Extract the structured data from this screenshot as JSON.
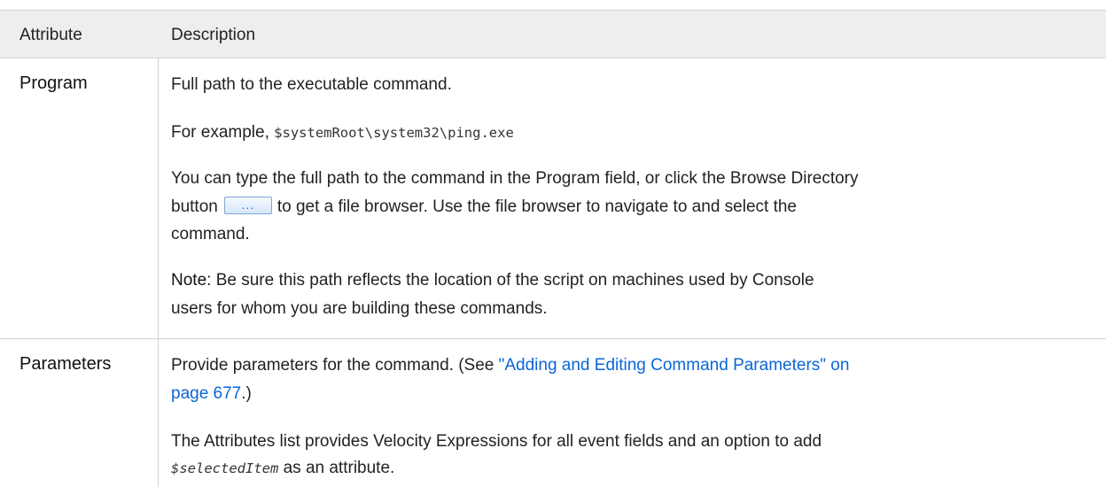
{
  "table": {
    "headers": {
      "attribute": "Attribute",
      "description": "Description"
    },
    "program": {
      "name": "Program",
      "line1": "Full path to the executable command.",
      "example_prefix": "For example, ",
      "example_path": "$systemRoot\\system32\\ping.exe",
      "para_line1": "You can type the full path to the command in the Program field, or click the Browse Directory",
      "para_line2a": "button",
      "browse_button_label": "...",
      "para_line2b": "to get a file browser. Use the file browser to navigate to and select the",
      "para_line3": "command.",
      "note_label": "Note:",
      "note_line1": " Be sure this path reflects the location of the script on machines used by Console",
      "note_line2": "users for whom you are building these commands."
    },
    "parameters": {
      "name": "Parameters",
      "line1_text": "Provide parameters for the command. (See ",
      "link_part1": "\"Adding and Editing Command Parameters\" on",
      "link_part2": "page 677",
      "line2_suffix": ".)",
      "para_line1": "The Attributes list provides Velocity Expressions for all event fields and an option to add",
      "selected_item": "$selectedItem",
      "para_line2_suffix": " as an attribute."
    }
  }
}
